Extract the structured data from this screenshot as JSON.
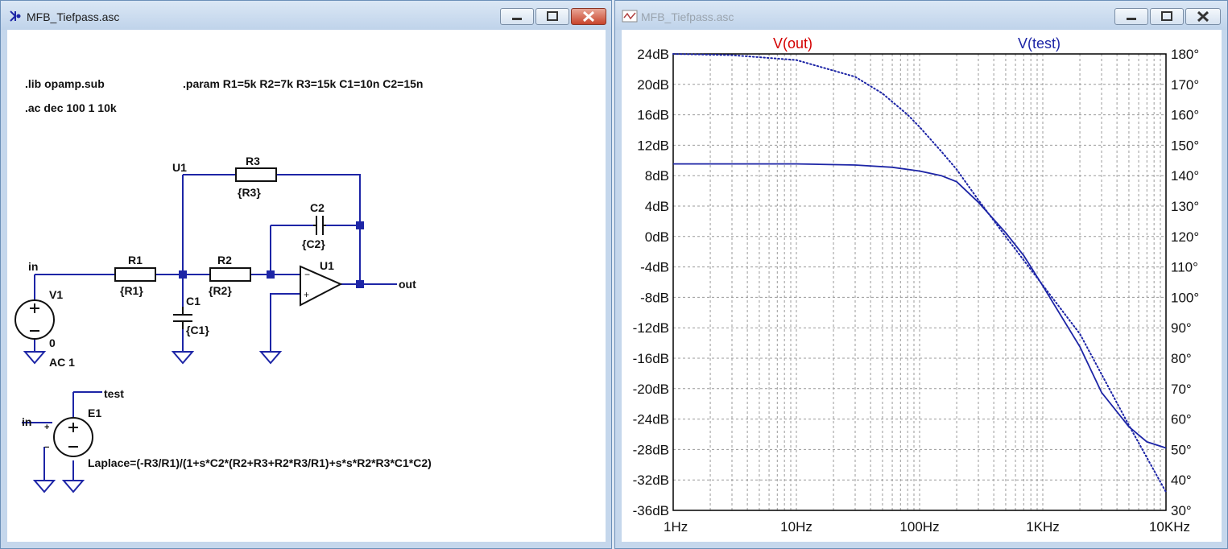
{
  "schematic_window": {
    "title": "MFB_Tiefpass.asc",
    "directives": {
      "lib": ".lib opamp.sub",
      "param": ".param R1=5k R2=7k R3=15k C1=10n C2=15n",
      "ac": ".ac dec 100 1 10k"
    },
    "components": {
      "r1_name": "R1",
      "r1_value": "{R1}",
      "r2_name": "R2",
      "r2_value": "{R2}",
      "r3_name": "R3",
      "r3_value": "{R3}",
      "c1_name": "C1",
      "c1_value": "{C1}",
      "c2_name": "C2",
      "c2_value": "{C2}",
      "u1_name": "U1",
      "v1_name": "V1",
      "v1_value": "AC 1",
      "e1_name": "E1",
      "e1_value": "Laplace=(-R3/R1)/(1+s*C2*(R2+R3+R2*R3/R1)+s*s*R2*R3*C1*C2)"
    },
    "nets": {
      "in": "in",
      "out": "out",
      "u1": "U1",
      "ground": "0",
      "test": "test",
      "e1_in": "in"
    }
  },
  "plot_window": {
    "title": "MFB_Tiefpass.asc",
    "trace_labels": [
      "V(out)",
      "V(test)"
    ]
  },
  "colors": {
    "wire": "#1d25a6",
    "component": "#111111",
    "trace_out": "#d40000",
    "trace_test": "#1d25a6",
    "grid": "#9a9a9a",
    "frame_active": "#c5d7ec",
    "close_button": "#c8442c"
  },
  "chart_data": {
    "type": "line",
    "title": "",
    "x_scale": "log",
    "xlim": [
      1,
      10000
    ],
    "x_ticks": [
      "1Hz",
      "10Hz",
      "100Hz",
      "1KHz",
      "10KHz"
    ],
    "ylim_left": [
      -36,
      24
    ],
    "y_ticks_left": [
      "24dB",
      "20dB",
      "16dB",
      "12dB",
      "8dB",
      "4dB",
      "0dB",
      "-4dB",
      "-8dB",
      "-12dB",
      "-16dB",
      "-20dB",
      "-24dB",
      "-28dB",
      "-32dB",
      "-36dB"
    ],
    "ylim_right": [
      30,
      180
    ],
    "y_ticks_right": [
      "180°",
      "170°",
      "160°",
      "150°",
      "140°",
      "130°",
      "120°",
      "110°",
      "100°",
      "90°",
      "80°",
      "70°",
      "60°",
      "50°",
      "40°",
      "30°"
    ],
    "grid": true,
    "series": [
      {
        "name": "V(test)",
        "style": "solid magnitude",
        "axis": "left (dB)",
        "x": [
          1,
          10,
          30,
          60,
          100,
          150,
          200,
          300,
          500,
          700,
          1000,
          2000,
          3000,
          5000,
          7000,
          10000
        ],
        "y": [
          9.54,
          9.54,
          9.4,
          9.1,
          8.6,
          8.0,
          7.2,
          4.5,
          0.5,
          -2.5,
          -6.5,
          -14.5,
          -20.5,
          -25,
          -27,
          -27.8
        ]
      },
      {
        "name": "V(test)",
        "style": "dotted phase",
        "axis": "right (deg)",
        "x": [
          1,
          3,
          10,
          30,
          50,
          80,
          100,
          150,
          200,
          300,
          500,
          1000,
          2000,
          5000,
          10000
        ],
        "y": [
          180,
          179.6,
          178,
          172.5,
          167,
          160,
          156,
          148,
          142,
          132,
          120,
          104,
          88,
          58,
          36
        ]
      }
    ]
  }
}
